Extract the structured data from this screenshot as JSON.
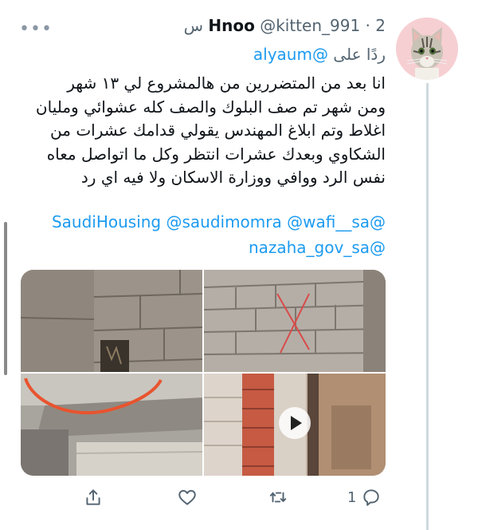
{
  "tweet": {
    "display_name": "Hnoo",
    "handle": "@kitten_991",
    "separator": "·",
    "time": "2 س",
    "replying_to_prefix": "ردًا على",
    "replying_to_handle": "@alyaum",
    "text_lines": [
      "انا بعد من  المتضررين من هالمشروع لي ١٣ شهر",
      "ومن شهر تم صف البلوك والصف كله عشوائي ومليان",
      "اغلاط وتم ابلاغ المهندس يقولي قدامك عشرات من",
      "الشكاوي وبعدك عشرات انتظر وكل ما اتواصل معاه",
      "نفس الرد ووافي ووزارة الاسكان ولا فيه اي رد"
    ],
    "tags_line1": "@SaudiHousing  @saudimomra @wafi__sa",
    "tags_line2": "@nazaha_gov_sa",
    "media": [
      {
        "icon": "photo-block-wall-gap"
      },
      {
        "icon": "photo-block-wall-red-x"
      },
      {
        "icon": "photo-concrete-slab-red-circle"
      },
      {
        "icon": "video-thumbnail-brick-wall",
        "play_icon": "play-icon"
      }
    ]
  },
  "actions": {
    "reply_icon": "reply-icon",
    "reply_count": "1",
    "retweet_icon": "retweet-icon",
    "like_icon": "heart-icon",
    "share_icon": "share-icon"
  },
  "more_icon": "more-icon",
  "avatar_icon": "cat-avatar",
  "colors": {
    "link": "#1d9bf0",
    "secondary_text": "#536471",
    "primary_text": "#0f1419",
    "thread_line": "#cfd9de",
    "avatar_bg": "#f6cfd2"
  }
}
